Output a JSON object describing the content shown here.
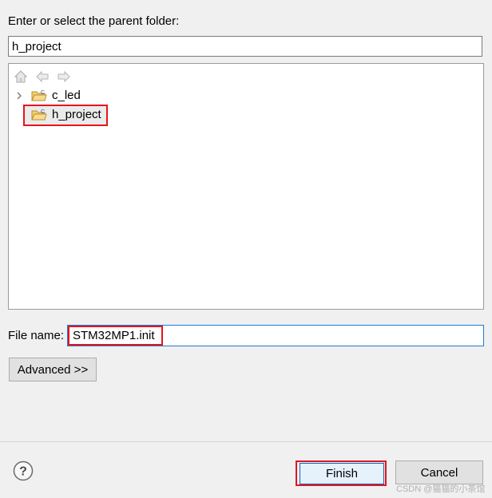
{
  "parent_folder": {
    "label": "Enter or select the parent folder:",
    "value": "h_project"
  },
  "tree": {
    "items": [
      {
        "label": "c_led",
        "icon": "project-folder-icon",
        "expandable": true
      },
      {
        "label": "h_project",
        "icon": "project-folder-icon",
        "selected": true
      }
    ]
  },
  "file": {
    "label": "File name:",
    "value": "STM32MP1.init"
  },
  "buttons": {
    "advanced": "Advanced >>",
    "finish": "Finish",
    "cancel": "Cancel"
  },
  "help_glyph": "?",
  "watermark": "CSDN @猫猫的小茶馆",
  "colors": {
    "highlight_red": "#e5141c",
    "focus_blue": "#1c7ed6",
    "dialog_bg": "#f0f0f0"
  }
}
